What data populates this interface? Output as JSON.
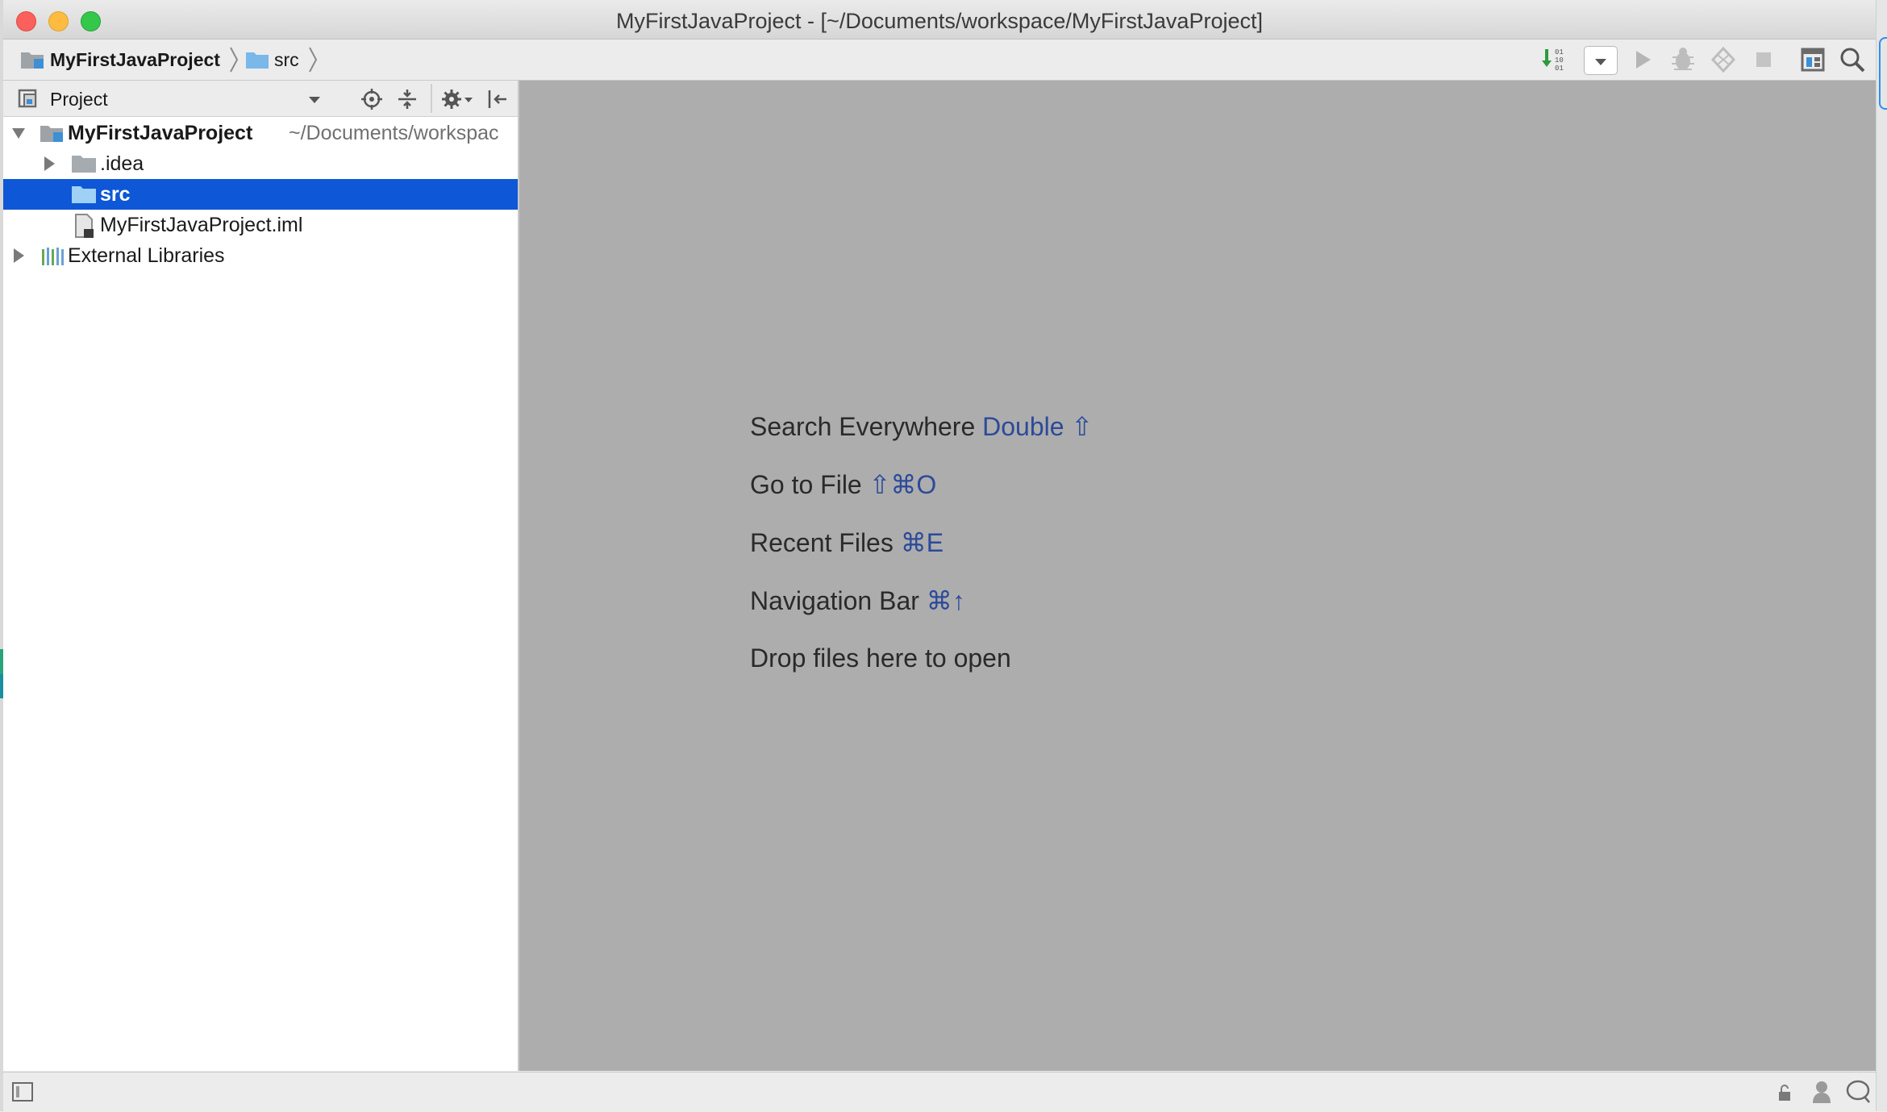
{
  "window": {
    "title": "MyFirstJavaProject - [~/Documents/workspace/MyFirstJavaProject]"
  },
  "navbar": {
    "breadcrumbs": [
      {
        "label": "MyFirstJavaProject",
        "icon": "project-folder-icon"
      },
      {
        "label": "src",
        "icon": "folder-icon"
      }
    ],
    "tools": [
      "sort-icon",
      "run-config-dropdown-icon",
      "run-icon",
      "debug-icon",
      "coverage-icon",
      "stop-icon",
      "project-structure-icon",
      "search-icon"
    ]
  },
  "project_panel": {
    "title": "Project",
    "tools": [
      "locate-icon",
      "collapse-all-icon",
      "settings-icon",
      "hide-panel-icon"
    ],
    "tree": [
      {
        "label": "MyFirstJavaProject",
        "path": "~/Documents/workspac",
        "expanded": true,
        "icon": "module-folder-icon"
      },
      {
        "label": ".idea",
        "expanded": false,
        "icon": "folder-icon"
      },
      {
        "label": "src",
        "selected": true,
        "icon": "source-folder-icon"
      },
      {
        "label": "MyFirstJavaProject.iml",
        "icon": "iml-file-icon"
      },
      {
        "label": "External Libraries",
        "expanded": false,
        "icon": "libraries-icon"
      }
    ]
  },
  "editor": {
    "hints": [
      {
        "label": "Search Everywhere",
        "shortcut": "Double ⇧"
      },
      {
        "label": "Go to File",
        "shortcut": "⇧⌘O"
      },
      {
        "label": "Recent Files",
        "shortcut": "⌘E"
      },
      {
        "label": "Navigation Bar",
        "shortcut": "⌘↑"
      },
      {
        "label": "Drop files here to open",
        "shortcut": ""
      }
    ]
  },
  "colors": {
    "selection": "#0e57d6",
    "editor_bg": "#adadad",
    "shortcut": "#2c4a9a"
  }
}
